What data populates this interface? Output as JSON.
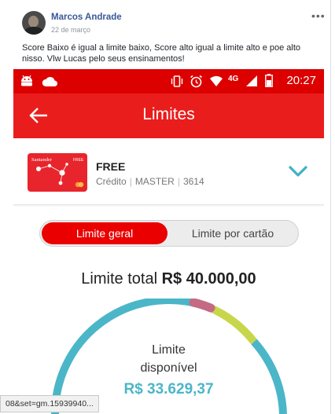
{
  "post": {
    "author": "Marcos Andrade",
    "date": "22 de março",
    "text": "Score Baixo é igual a limite baixo, Score alto igual a limite alto e poe alto nisso. Vlw Lucas pelo seus ensinamentos!",
    "menu_icon": "more-options-icon"
  },
  "phone": {
    "status_bar": {
      "time": "20:27",
      "network": "4G",
      "icons": [
        "android-icon",
        "cloud-icon",
        "vibrate-icon",
        "alarm-icon",
        "signal-icon",
        "battery-icon"
      ]
    },
    "app_bar": {
      "title": "Limites"
    },
    "card": {
      "brand": "Santander",
      "name": "FREE",
      "type": "Crédito",
      "network": "MASTER",
      "last_digits": "3614"
    },
    "tabs": [
      {
        "label": "Limite geral",
        "selected": true
      },
      {
        "label": "Limite por cartão",
        "selected": false
      }
    ],
    "limit": {
      "total_label": "Limite total",
      "total_value": "R$ 40.000,00",
      "available_label_line1": "Limite",
      "available_label_line2": "disponível",
      "available_value": "R$ 33.629,37"
    },
    "colors": {
      "brand_red": "#ea1d1d",
      "status_red": "#dc0000",
      "available": "#4bb6c8",
      "used_segment_1": "#c8d64b",
      "used_segment_2": "#c56a83"
    }
  },
  "status_url": "08&set=gm.15939940..."
}
